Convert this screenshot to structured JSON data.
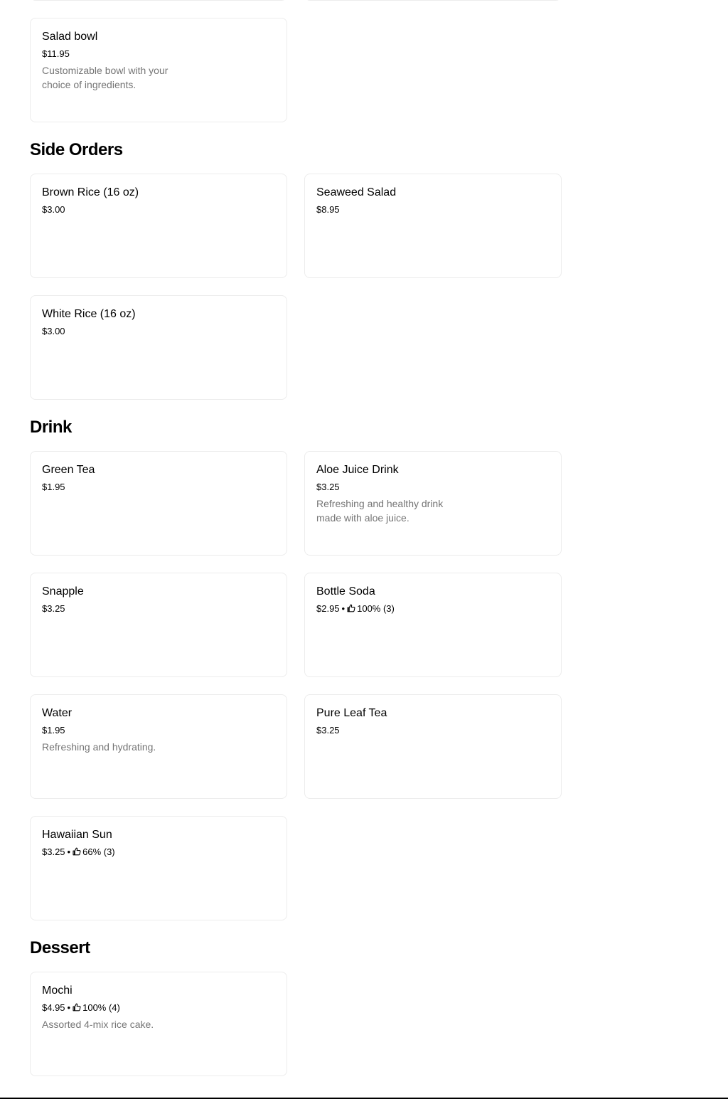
{
  "top_partial": {},
  "sections": {
    "bowls": {
      "items": [
        {
          "name": "Salad bowl",
          "price": "$11.95",
          "description": "Customizable bowl with your choice of ingredients."
        }
      ]
    },
    "side_orders": {
      "title": "Side Orders",
      "items": [
        {
          "name": "Brown Rice (16 oz)",
          "price": "$3.00"
        },
        {
          "name": "Seaweed Salad",
          "price": "$8.95"
        },
        {
          "name": "White Rice (16 oz)",
          "price": "$3.00"
        }
      ]
    },
    "drink": {
      "title": "Drink",
      "items": [
        {
          "name": "Green Tea",
          "price": "$1.95"
        },
        {
          "name": "Aloe Juice Drink",
          "price": "$3.25",
          "description": "Refreshing and healthy drink made with aloe juice."
        },
        {
          "name": "Snapple",
          "price": "$3.25"
        },
        {
          "name": "Bottle Soda",
          "price": "$2.95",
          "separator": "•",
          "rating": "100% (3)",
          "rating_icon": "thumbs-up-icon"
        },
        {
          "name": "Water",
          "price": "$1.95",
          "description": "Refreshing and hydrating."
        },
        {
          "name": "Pure Leaf Tea",
          "price": "$3.25"
        },
        {
          "name": "Hawaiian Sun",
          "price": "$3.25",
          "separator": "•",
          "rating": "66% (3)",
          "rating_icon": "thumbs-up-icon"
        }
      ]
    },
    "dessert": {
      "title": "Dessert",
      "items": [
        {
          "name": "Mochi",
          "price": "$4.95",
          "separator": "•",
          "rating": "100% (4)",
          "rating_icon": "thumbs-up-icon",
          "description": "Assorted 4-mix rice cake."
        }
      ]
    }
  },
  "colors": {
    "text": "#000000",
    "description": "#757575",
    "card_border": "#ececec",
    "background": "#ffffff"
  }
}
